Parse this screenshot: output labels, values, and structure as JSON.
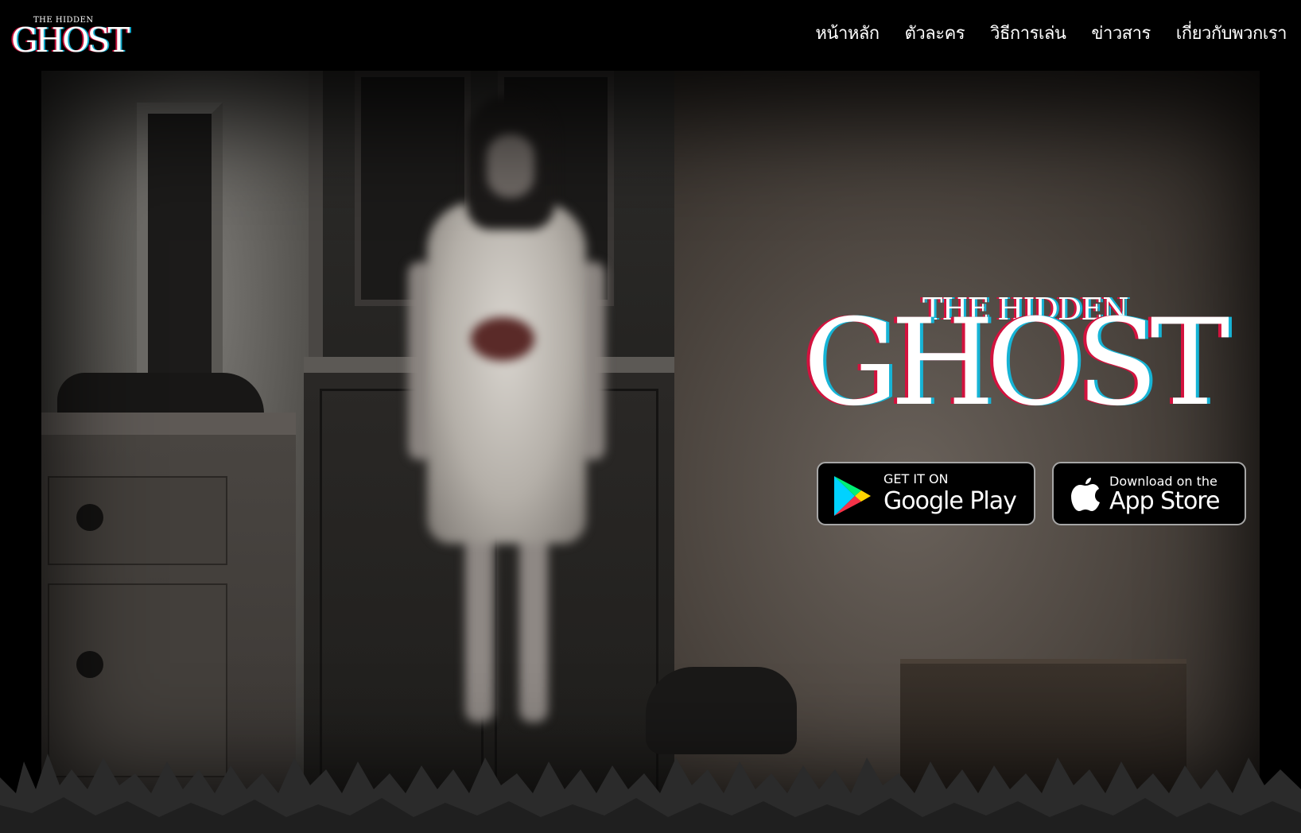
{
  "brand": {
    "logo_small_top": "THE HIDDEN",
    "logo_small_main": "GHOST"
  },
  "nav": {
    "items": [
      {
        "label": "หน้าหลัก"
      },
      {
        "label": "ตัวละคร"
      },
      {
        "label": "วิธีการเล่น"
      },
      {
        "label": "ข่าวสาร"
      },
      {
        "label": "เกี่ยวกับพวกเรา"
      }
    ]
  },
  "hero": {
    "logo_sub": "THE HIDDEN",
    "logo_main": "GHOST",
    "google_play": {
      "small": "GET IT ON",
      "big": "Google Play",
      "icon": "google-play-icon"
    },
    "app_store": {
      "small": "Download on the",
      "big": "App Store",
      "icon": "apple-icon"
    }
  },
  "colors": {
    "glitch_red": "#d3123e",
    "glitch_cyan": "#16b4d6",
    "badge_border": "#a6a6a6"
  }
}
